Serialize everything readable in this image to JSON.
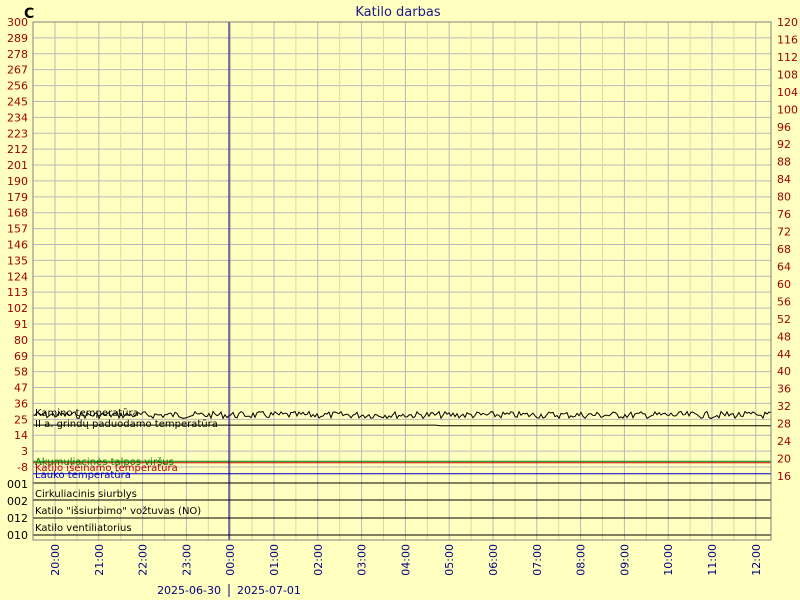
{
  "chart_data": {
    "type": "line",
    "title": "Katilo darbas",
    "left_unit": "C",
    "left_ticks": [
      "300",
      "289",
      "278",
      "267",
      "256",
      "245",
      "234",
      "223",
      "212",
      "201",
      "190",
      "179",
      "168",
      "157",
      "146",
      "135",
      "124",
      "113",
      "102",
      "91",
      "80",
      "69",
      "58",
      "47",
      "36",
      "25",
      "14",
      "3",
      "-8"
    ],
    "right_ticks": [
      "120",
      "116",
      "112",
      "108",
      "104",
      "100",
      "96",
      "92",
      "88",
      "84",
      "80",
      "76",
      "72",
      "68",
      "64",
      "60",
      "56",
      "52",
      "48",
      "44",
      "40",
      "36",
      "32",
      "28",
      "24",
      "20",
      "16"
    ],
    "logic_ticks": [
      "001",
      "002",
      "012",
      "010"
    ],
    "x_ticks": [
      "20:00",
      "21:00",
      "22:00",
      "23:00",
      "00:00",
      "01:00",
      "02:00",
      "03:00",
      "04:00",
      "05:00",
      "06:00",
      "07:00",
      "08:00",
      "09:00",
      "10:00",
      "11:00",
      "12:00"
    ],
    "date_labels": [
      "2025-06-30",
      "2025-07-01"
    ],
    "ylim_left": [
      -8,
      300
    ],
    "ylim_right": [
      16,
      120
    ],
    "series": [
      {
        "name": "Kamino temperatūra",
        "color": "#000000",
        "axis": "left",
        "approx_value": 28,
        "noisy": true
      },
      {
        "name": "II a. grindų paduodamo temperatūra",
        "color": "#000000",
        "axis": "left",
        "approx_value": 21,
        "step_down_at": "04:45",
        "step_value": 20.5
      },
      {
        "name": "Akumuliacinės talpos viršus",
        "color": "#008000",
        "axis": "left",
        "approx_value": -4
      },
      {
        "name": "Katilo išeinamo temperatūra",
        "color": "#c00000",
        "axis": "left",
        "approx_value": -5
      },
      {
        "name": "Lauko temperatūra",
        "color": "#0000c0",
        "axis": "right",
        "approx_value": 16.5
      }
    ],
    "digital_series": [
      "Cirkuliacinis siurblys",
      "Katilo \"išsiurbimo\" vožtuvas (NO)",
      "Katilo ventiliatorius"
    ],
    "grid": true,
    "legend": "inline-left"
  }
}
